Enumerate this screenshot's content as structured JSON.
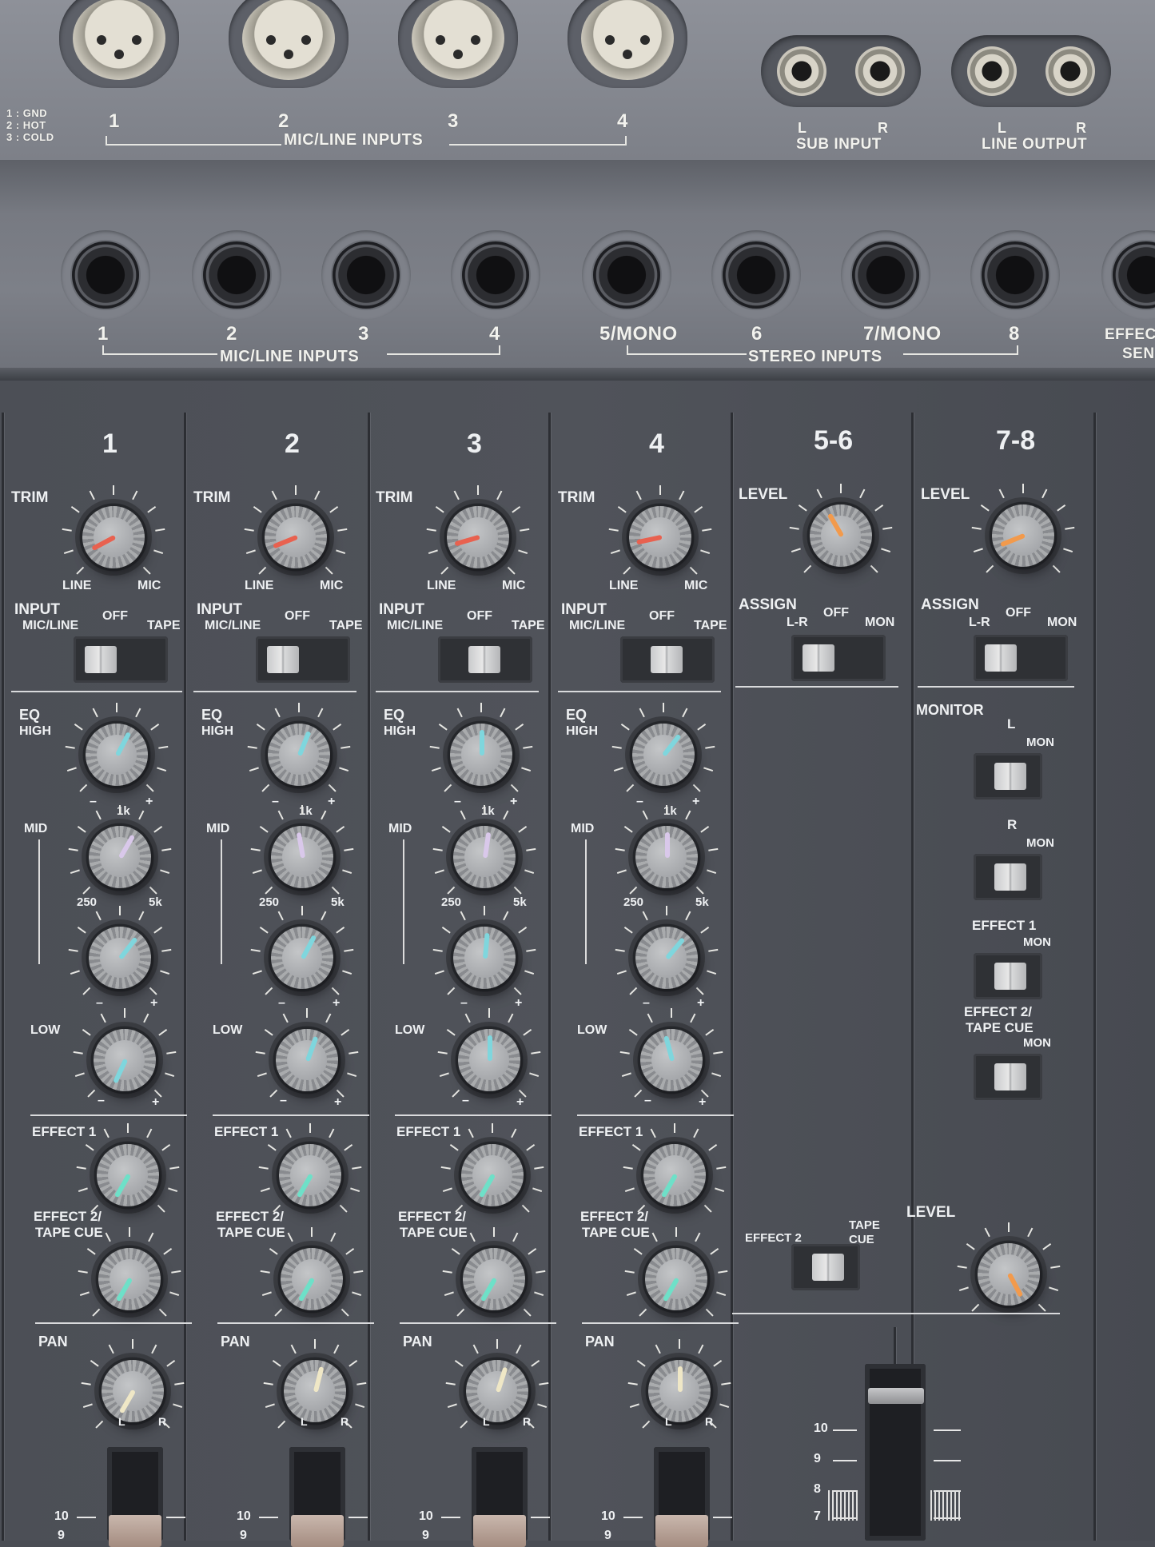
{
  "rear_panel": {
    "pin_legend": [
      "1 : GND",
      "2 : HOT",
      "3 : COLD"
    ],
    "xlr_numbers": [
      "1",
      "2",
      "3",
      "4"
    ],
    "xlr_group_label": "MIC/LINE INPUTS",
    "sub_input": {
      "left": "L",
      "right": "R",
      "label": "SUB INPUT"
    },
    "line_output": {
      "left": "L",
      "right": "R",
      "label": "LINE OUTPUT"
    },
    "jack_numbers": [
      "1",
      "2",
      "3",
      "4",
      "5/MONO",
      "6",
      "7/MONO",
      "8"
    ],
    "jack_group_mic": "MIC/LINE INPUTS",
    "jack_group_stereo": "STEREO INPUTS",
    "effect_send_partial": [
      "EFFEC",
      "SEN"
    ]
  },
  "channels": [
    {
      "number": "1"
    },
    {
      "number": "2"
    },
    {
      "number": "3"
    },
    {
      "number": "4"
    }
  ],
  "channel_labels": {
    "trim": "TRIM",
    "line": "LINE",
    "mic": "MIC",
    "input": "INPUT",
    "mic_line": "MIC/LINE",
    "off": "OFF",
    "tape": "TAPE",
    "eq": "EQ",
    "high": "HIGH",
    "mid": "MID",
    "low": "LOW",
    "minus": "–",
    "plus": "+",
    "freq_1k": "1k",
    "freq_250": "250",
    "freq_5k": "5k",
    "effect1": "EFFECT 1",
    "effect2": "EFFECT 2/",
    "tape_cue": "TAPE CUE",
    "pan": "PAN",
    "l": "L",
    "r": "R"
  },
  "stereo_channels": [
    {
      "number": "5-6",
      "level": "LEVEL",
      "assign": "ASSIGN",
      "lr": "L-R",
      "off": "OFF",
      "mon": "MON"
    },
    {
      "number": "7-8",
      "level": "LEVEL",
      "assign": "ASSIGN",
      "lr": "L-R",
      "off": "OFF",
      "mon": "MON"
    }
  ],
  "monitor": {
    "title": "MONITOR",
    "items": [
      {
        "top": "L",
        "mon": "MON"
      },
      {
        "top": "R",
        "mon": "MON"
      },
      {
        "top": "EFFECT 1",
        "mon": "MON"
      },
      {
        "top": "EFFECT 2/",
        "top2": "TAPE CUE",
        "mon": "MON"
      }
    ],
    "level": "LEVEL"
  },
  "effect2_switch": {
    "left": "EFFECT 2",
    "right_top": "TAPE",
    "right_bottom": "CUE"
  },
  "fader_scale": [
    "10",
    "9",
    "8",
    "7"
  ],
  "colors": {
    "trim_pointer": "#e8614f",
    "eq_pointer": "#7fd6dd",
    "mid_pointer": "#d9c8ea",
    "effect_pointer": "#6ee0c8",
    "pan_pointer": "#efe7c6",
    "level_pointer": "#f29a4c"
  }
}
